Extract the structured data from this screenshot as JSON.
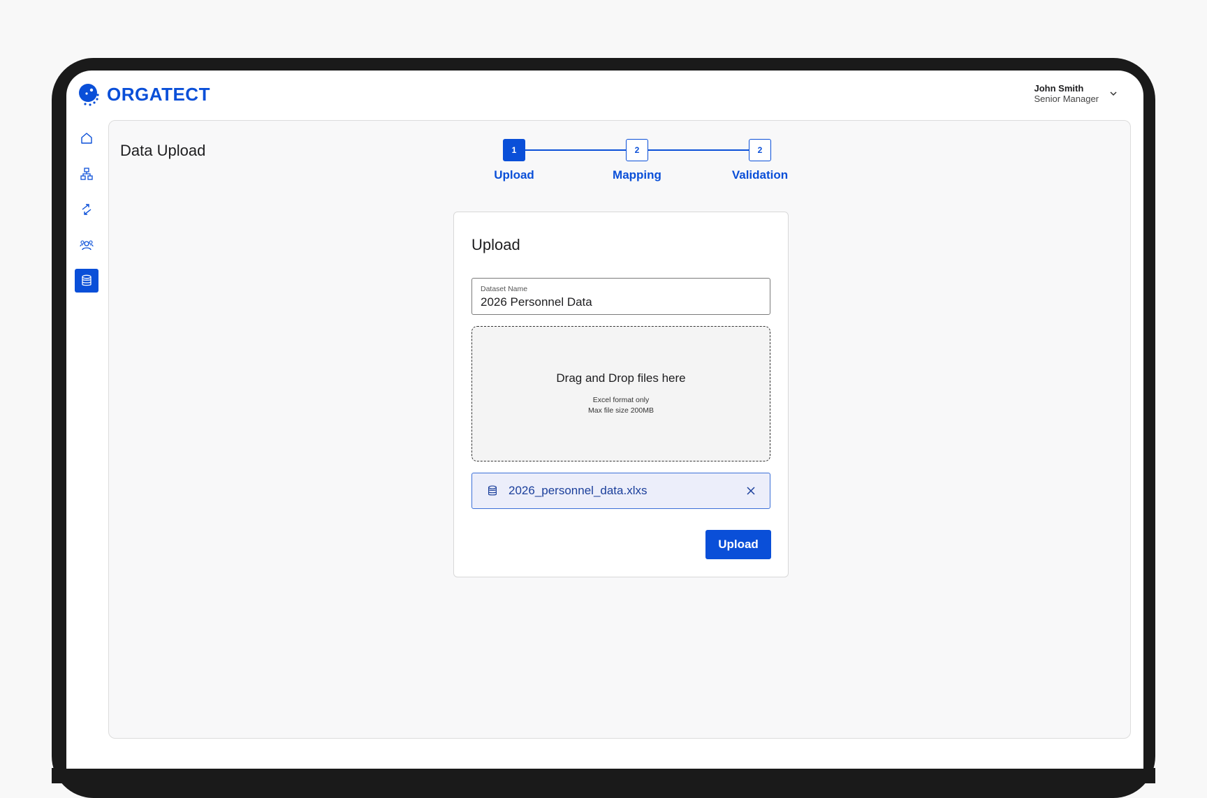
{
  "app": {
    "brand": "ORGATECT"
  },
  "user": {
    "name": "John Smith",
    "role": "Senior Manager"
  },
  "sidebar": {
    "items": [
      {
        "icon": "home-icon",
        "active": false
      },
      {
        "icon": "org-chart-icon",
        "active": false
      },
      {
        "icon": "transfer-arrows-icon",
        "active": false
      },
      {
        "icon": "people-icon",
        "active": false
      },
      {
        "icon": "database-icon",
        "active": true
      }
    ]
  },
  "page": {
    "title": "Data Upload"
  },
  "stepper": {
    "steps": [
      {
        "number": "1",
        "label": "Upload",
        "active": true
      },
      {
        "number": "2",
        "label": "Mapping",
        "active": false
      },
      {
        "number": "2",
        "label": "Validation",
        "active": false
      }
    ]
  },
  "card": {
    "title": "Upload",
    "dataset_field": {
      "label": "Dataset Name",
      "value": "2026 Personnel Data"
    },
    "dropzone": {
      "title": "Drag and Drop files here",
      "note_line1": "Excel format only",
      "note_line2": "Max file size 200MB"
    },
    "file": {
      "name": "2026_personnel_data.xlxs",
      "icon": "database-icon"
    },
    "upload_button": "Upload"
  },
  "colors": {
    "accent": "#0a4fd8",
    "file_chip_bg": "#eceefa"
  }
}
